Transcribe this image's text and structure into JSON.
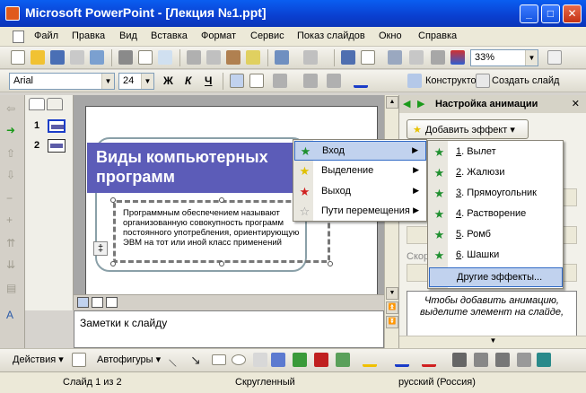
{
  "window": {
    "title": "Microsoft PowerPoint - [Лекция №1.ppt]",
    "min": "_",
    "max": "□",
    "close": "✕"
  },
  "menu": [
    "Файл",
    "Правка",
    "Вид",
    "Вставка",
    "Формат",
    "Сервис",
    "Показ слайдов",
    "Окно",
    "Справка"
  ],
  "help_close": "✕",
  "toolbar1": {
    "zoom": "33%"
  },
  "toolbar2": {
    "font": "Arial",
    "size": "24",
    "bold": "Ж",
    "italic": "К",
    "underline": "Ч",
    "designer": "Конструктор",
    "new_slide": "Создать слайд"
  },
  "slides_pane": {
    "items": [
      "1",
      "2"
    ]
  },
  "slide": {
    "title": "Виды компьютерных программ",
    "body": "Программным обеспечением называют организованную совокупность программ постоянного употребления, ориентирующую ЭВМ на тот или иной класс применений"
  },
  "notes": "Заметки к слайду",
  "taskpane": {
    "title": "Настройка анимации",
    "add_effect": "Добавить эффект",
    "modify_label": "Скор",
    "hint": "Чтобы добавить анимацию, выделите элемент на слайде,"
  },
  "effect_menu": {
    "items": [
      {
        "label": "Вход",
        "ul": "В",
        "icon_color": "#1f8f2f"
      },
      {
        "label": "Выделение",
        "ul": "ы",
        "icon_color": "#e0c000"
      },
      {
        "label": "Выход",
        "ul": "х",
        "icon_color": "#d02020"
      },
      {
        "label": "Пути перемещения",
        "ul": "П",
        "icon_color": "#999999"
      }
    ]
  },
  "entrance_menu": {
    "items": [
      {
        "num": "1",
        "label": ". Вылет"
      },
      {
        "num": "2",
        "label": ". Жалюзи"
      },
      {
        "num": "3",
        "label": ". Прямоугольник"
      },
      {
        "num": "4",
        "label": ". Растворение"
      },
      {
        "num": "5",
        "label": ". Ромб"
      },
      {
        "num": "6",
        "label": ". Шашки"
      }
    ],
    "more": "Другие эффекты..."
  },
  "drawbar": {
    "actions": "Действия",
    "autoshapes": "Автофигуры"
  },
  "status": {
    "slide": "Слайд 1 из 2",
    "design": "Скругленный",
    "lang": "русский (Россия)"
  },
  "colors": {
    "title_bar": "#0a4ee0",
    "slide_title_bg": "#5c5cb8",
    "menu_highlight": "#c1d2ee"
  }
}
